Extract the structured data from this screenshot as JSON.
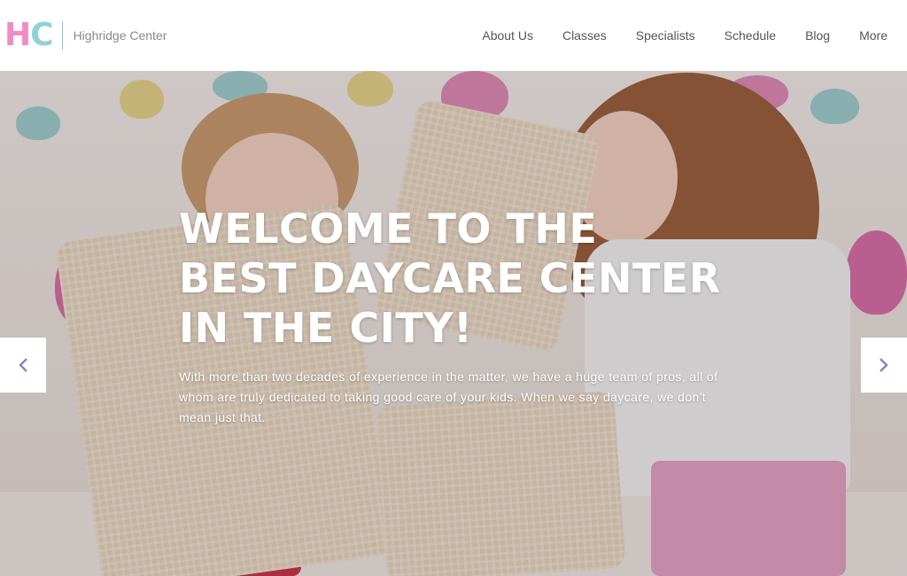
{
  "brand": {
    "mark_h": "H",
    "mark_c": "C",
    "name": "Highridge Center"
  },
  "nav": {
    "items": [
      "About Us",
      "Classes",
      "Specialists",
      "Schedule",
      "Blog",
      "More"
    ]
  },
  "hero": {
    "title_lines": [
      "WELCOME TO THE",
      "BEST DAYCARE CENTER",
      "IN THE CITY!"
    ],
    "text": "With more than two decades of experience in the matter, we have a huge team of pros, all of whom are truly dedicated to taking good care of your kids. When we say daycare, we don't mean just that."
  },
  "slider": {
    "prev_icon": "chevron-left-icon",
    "next_icon": "chevron-right-icon"
  },
  "colors": {
    "logo_pink": "#f08cc4",
    "logo_teal": "#8fd3d8",
    "arrow": "#7b8bb8"
  }
}
